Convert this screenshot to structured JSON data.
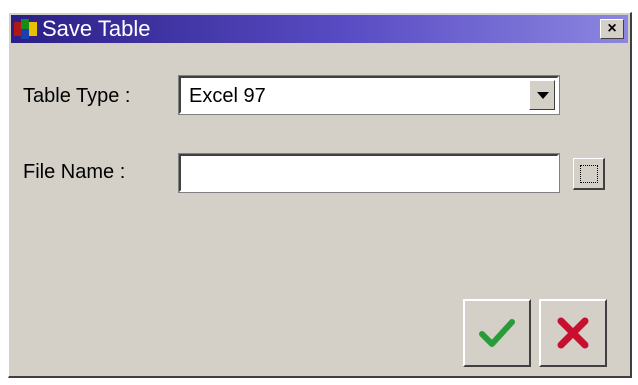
{
  "window": {
    "title": "Save Table",
    "close_label": "×"
  },
  "form": {
    "table_type_label": "Table Type :",
    "table_type_value": "Excel 97",
    "file_name_label": "File Name :",
    "file_name_value": "",
    "file_name_placeholder": ""
  },
  "icons": {
    "app": "app-icon",
    "dropdown": "chevron-down-icon",
    "browse": "browse-icon",
    "ok": "checkmark-icon",
    "cancel": "cross-icon"
  },
  "colors": {
    "title_gradient_start": "#2a1f86",
    "title_gradient_end": "#8c86e0",
    "ok_green": "#2a9b3a",
    "cancel_red": "#c8102e"
  }
}
